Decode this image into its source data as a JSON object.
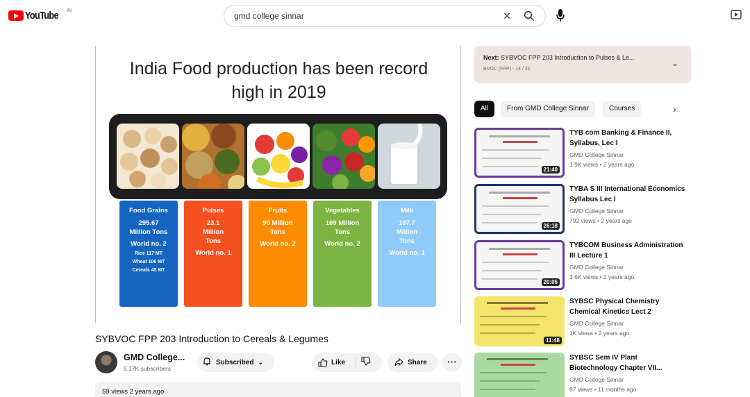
{
  "header": {
    "logo_text": "YouTube",
    "logo_country": "IN",
    "search_value": "gmd college sinnar",
    "search_icon": "search-icon",
    "clear_icon": "close-icon",
    "mic_icon": "microphone-icon",
    "cast_icon": "cast-icon"
  },
  "player": {
    "slide_title_line1": "India Food production has been record",
    "slide_title_line2": "high in 2019",
    "columns": [
      {
        "label": "Food Grains",
        "line2": "295.67",
        "line3": "Million Tons",
        "line4": "World no. 2",
        "small1": "Rice 117 MT",
        "small2": "Wheat 106 MT",
        "small3": "Cereals 45 MT",
        "color": "#1565c0"
      },
      {
        "label": "Pulses",
        "line2": "23.1",
        "line3": "Million",
        "line4": "Tons",
        "line5": "World no. 1",
        "color": "#f4511e"
      },
      {
        "label": "Fruits",
        "line2": "90 Million",
        "line3": "Tons",
        "line4": "World no. 2",
        "color": "#fb8c00"
      },
      {
        "label": "Vegetables",
        "line2": "169 Million",
        "line3": "Tons",
        "line4": "World no. 2",
        "color": "#7cb342"
      },
      {
        "label": "Milk",
        "line2": "187.7",
        "line3": "Million",
        "line4": "Tons",
        "line5": "World no. 1",
        "color": "#90caf9"
      }
    ]
  },
  "video": {
    "title": "SYBVOC FPP 203 Introduction to Cereals & Legumes",
    "channel": "GMD College...",
    "subscribers": "5.17K subscribers",
    "subscribe_label": "Subscribed",
    "like_label": "Like",
    "share_label": "Share",
    "more_label": "···",
    "desc_meta": "59 views  2 years ago"
  },
  "sidebar": {
    "next_prefix": "Next:",
    "next_title": "SYBVOC FPP 203 Introduction to Pulses & Le...",
    "next_sub": "BVOC (FPP) - 14 / 21",
    "chips": [
      "All",
      "From GMD College Sinnar",
      "Courses"
    ],
    "recommendations": [
      {
        "title": "TYB com Banking & Finance II, Syllabus, Lec I",
        "channel": "GMD College Sinnar",
        "meta": "1.9K views • 2 years ago",
        "duration": "21:40",
        "style": "purple"
      },
      {
        "title": "TYBA S III International Economics Syllabus Lec I",
        "channel": "GMD College Sinnar",
        "meta": "792 views • 2 years ago",
        "duration": "26:18",
        "style": "blue"
      },
      {
        "title": "TYBCOM Business Administration III Lecture 1",
        "channel": "GMD College Sinnar",
        "meta": "3.6K views • 2 years ago",
        "duration": "20:05",
        "style": "purple"
      },
      {
        "title": "SYBSC Physical Chemistry Chemical Kinetics Lect 2",
        "channel": "GMD College Sinnar",
        "meta": "1K views • 2 years ago",
        "duration": "11:48",
        "style": "yellow"
      },
      {
        "title": "SYBSC Sem IV Plant Biotechnology Chapter VII...",
        "channel": "GMD College Sinnar",
        "meta": "87 views • 11 months ago",
        "duration": "",
        "style": "green"
      }
    ]
  }
}
